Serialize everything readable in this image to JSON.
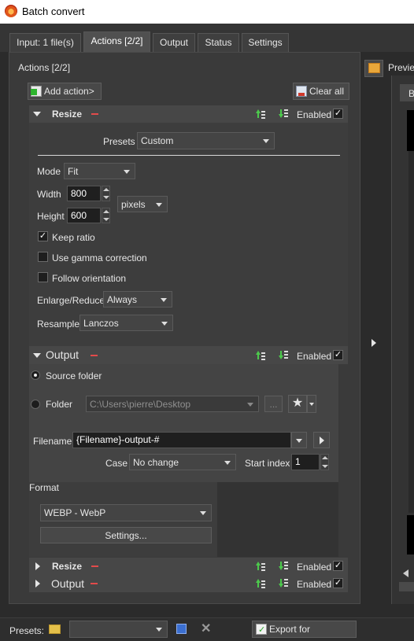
{
  "window": {
    "title": "Batch convert"
  },
  "tabs": [
    {
      "label": "Input: 1 file(s)"
    },
    {
      "label": "Actions [2/2]"
    },
    {
      "label": "Output"
    },
    {
      "label": "Status"
    },
    {
      "label": "Settings"
    }
  ],
  "actions_panel": {
    "title": "Actions [2/2]",
    "add_action": "Add action>",
    "clear_all": "Clear all"
  },
  "resize": {
    "title": "Resize",
    "enabled_label": "Enabled",
    "presets_label": "Presets",
    "presets_value": "Custom",
    "mode_label": "Mode",
    "mode_value": "Fit",
    "width_label": "Width",
    "width_value": "800",
    "height_label": "Height",
    "height_value": "600",
    "unit_value": "pixels",
    "keep_ratio": "Keep ratio",
    "gamma": "Use gamma correction",
    "orientation": "Follow orientation",
    "enlarge_label": "Enlarge/Reduce",
    "enlarge_value": "Always",
    "resample_label": "Resample",
    "resample_value": "Lanczos"
  },
  "output": {
    "title": "Output",
    "enabled_label": "Enabled",
    "source_folder": "Source folder",
    "folder_label": "Folder",
    "folder_path": "C:\\Users\\pierre\\Desktop",
    "more_button": "...",
    "filename_label": "Filename",
    "filename_value": "{Filename}-output-#",
    "case_label": "Case",
    "case_value": "No change",
    "start_index_label": "Start index",
    "start_index_value": "1",
    "format_label": "Format",
    "format_value": "WEBP - WebP",
    "settings_button": "Settings..."
  },
  "collapsed_actions": [
    {
      "title": "Resize",
      "enabled_label": "Enabled"
    },
    {
      "title": "Output",
      "enabled_label": "Enabled"
    }
  ],
  "preview": {
    "label": "Preview",
    "tab_letter": "B"
  },
  "bottom": {
    "presets_label": "Presets:",
    "presets_value": "",
    "export_button": "Export for NConvert..."
  }
}
